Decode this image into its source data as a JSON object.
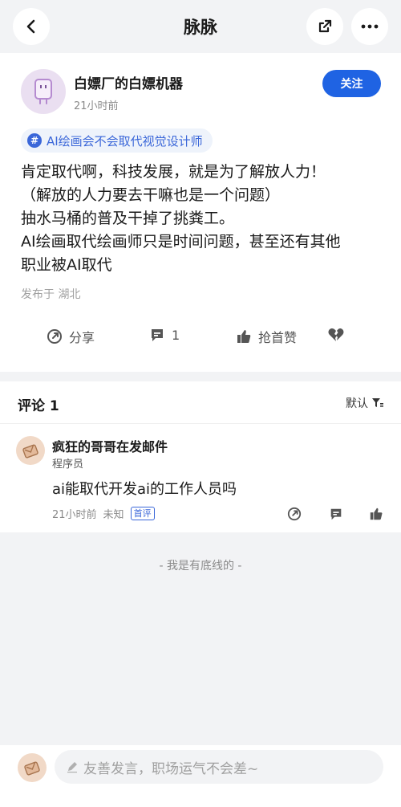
{
  "nav": {
    "title": "脉脉",
    "back_icon": "back-arrow-icon",
    "share_icon": "external-share-icon",
    "more_icon": "more-dots-icon"
  },
  "post": {
    "author": "白嫖厂的白嫖机器",
    "time": "21小时前",
    "follow_label": "关注",
    "topic": "AI绘画会不会取代视觉设计师",
    "content_lines": [
      "肯定取代啊，科技发展，就是为了解放人力！",
      "（解放的人力要去干嘛也是一个问题）",
      "抽水马桶的普及干掉了挑粪工。",
      "AI绘画取代绘画师只是时间问题，甚至还有其他",
      "职业被AI取代"
    ],
    "location": "发布于 湖北",
    "actions": {
      "share_label": "分享",
      "comment_count": "1",
      "like_label": "抢首赞"
    }
  },
  "comments": {
    "title": "评论 1",
    "sort_label": "默认",
    "items": [
      {
        "name": "疯狂的哥哥在发邮件",
        "role": "程序员",
        "text": "ai能取代开发ai的工作人员吗",
        "time": "21小时前",
        "source": "未知",
        "badge": "首评"
      }
    ]
  },
  "footer": {
    "bottom_line": "- 我是有底线的 -",
    "input_placeholder": "友善发言，职场运气不会差~"
  },
  "colors": {
    "accent": "#1f63e3",
    "topic": "#3b67d9",
    "background": "#f2f3f5"
  }
}
